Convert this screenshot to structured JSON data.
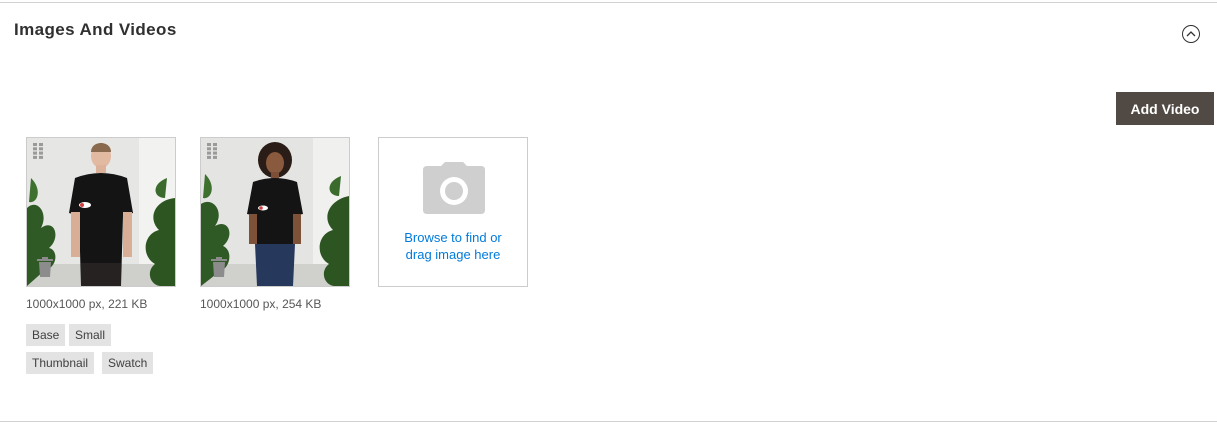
{
  "section": {
    "title": "Images And Videos",
    "collapse_icon": "chevron-up-circle-icon"
  },
  "toolbar": {
    "add_video_label": "Add Video"
  },
  "images": [
    {
      "meta": "1000x1000 px, 221 KB",
      "roles": [
        "Base",
        "Small",
        "Thumbnail",
        "Swatch"
      ]
    },
    {
      "meta": "1000x1000 px, 254 KB",
      "roles": []
    }
  ],
  "uploader": {
    "line1": "Browse to find or",
    "line2": "drag image here",
    "icon": "camera-icon"
  },
  "colors": {
    "button_bg": "#514943",
    "link": "#007bdb",
    "tag_bg": "#e3e3e3",
    "divider": "#d1d1d1"
  }
}
